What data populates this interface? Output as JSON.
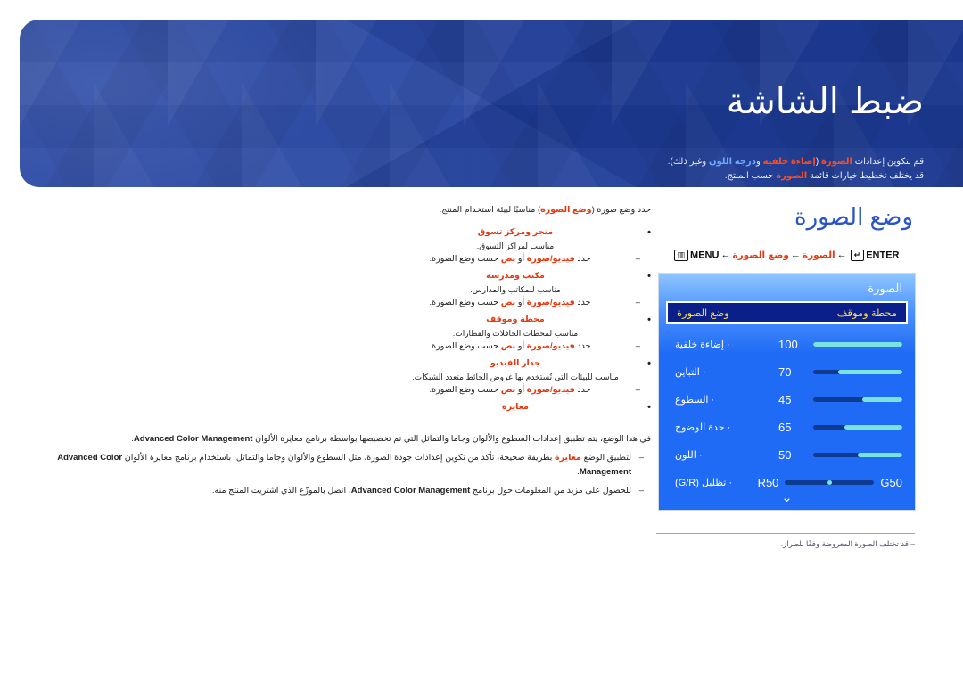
{
  "banner": {
    "title": "ضبط الشاشة",
    "sub_line1_pre": "قم بتكوين إعدادات ",
    "sub_line1_hl1": "الصورة",
    "sub_line1_mid": " (",
    "sub_line1_hl2": "إضاءة خلفية",
    "sub_line1_mid2": " و",
    "sub_line1_hl3": "درجة اللون",
    "sub_line1_end": " وغير ذلك).",
    "sub_line2_pre": "قد يختلف تخطيط خيارات قائمة ",
    "sub_line2_hl": "الصورة",
    "sub_line2_end": " حسب المنتج."
  },
  "section": {
    "title": "وضع الصورة",
    "menu_path": {
      "menu_label": "MENU",
      "menu_icon": "menu-grid-icon",
      "arrow": "←",
      "step1": "الصورة",
      "step2": "وضع الصورة",
      "enter_label": "ENTER",
      "enter_icon": "enter-key-icon"
    }
  },
  "osd": {
    "title": "الصورة",
    "highlight": {
      "label": "وضع الصورة",
      "value": "محطة وموقف"
    },
    "rows": [
      {
        "label": "· إضاءة خلفية",
        "value": "100",
        "fill_pct": 100
      },
      {
        "label": "· التباين",
        "value": "70",
        "fill_pct": 72
      },
      {
        "label": "· السطوع",
        "value": "45",
        "fill_pct": 45
      },
      {
        "label": "· حدة الوضوح",
        "value": "65",
        "fill_pct": 65
      },
      {
        "label": "· اللون",
        "value": "50",
        "fill_pct": 50
      }
    ],
    "rg_row": {
      "label": "· تظليل (G/R)",
      "left_value": "R50",
      "right_value": "G50"
    },
    "scroll_arrow": "chevron-down-icon",
    "note": "–  قد تختلف الصورة المعروضة وفقًا للطراز."
  },
  "content": {
    "lead_pre": "حدد وضع صورة (",
    "lead_hl": "وضع الصورة",
    "lead_post": ") مناسبًا لبيئة استخدام المنتج.",
    "items": [
      {
        "head": "متجر ومركز تسوق",
        "desc": "مناسب لمراكز التسوق.",
        "sub_pre": "حدد ",
        "sub_hl1": "فيديو/صورة",
        "sub_mid": " أو ",
        "sub_hl2": "نص",
        "sub_post": " حسب وضع الصورة."
      },
      {
        "head": "مكتب ومدرسة",
        "desc": "مناسب للمكاتب والمدارس.",
        "sub_pre": "حدد ",
        "sub_hl1": "فيديو/صورة",
        "sub_mid": " أو ",
        "sub_hl2": "نص",
        "sub_post": " حسب وضع الصورة."
      },
      {
        "head": "محطة وموقف",
        "desc": "مناسب لمحطات الحافلات والقطارات.",
        "sub_pre": "حدد ",
        "sub_hl1": "فيديو/صورة",
        "sub_mid": " أو ",
        "sub_hl2": "نص",
        "sub_post": " حسب وضع الصورة."
      },
      {
        "head": "جدار الفيديو",
        "desc": "مناسب للبيئات التي تُستخدم بها عروض الحائط متعدد الشبكات.",
        "sub_pre": "حدد ",
        "sub_hl1": "فيديو/صورة",
        "sub_mid": " أو ",
        "sub_hl2": "نص",
        "sub_post": " حسب وضع الصورة."
      }
    ],
    "calibration": {
      "head": "معايرة",
      "para1_pre": "في هذا الوضع، يتم تطبيق إعدادات السطوع والألوان وجاما والتماثل التي تم تخصيصها بواسطة برنامج معايرة الألوان ",
      "para1_bold": "Advanced Color Management",
      "para1_post": ".",
      "dash1_pre": "لتطبيق الوضع ",
      "dash1_hl": "معايرة",
      "dash1_mid": " بطريقة صحيحة، تأكد من تكوين إعدادات جودة الصورة، مثل السطوع والألوان وجاما والتماثل، باستخدام برنامج معايرة الألوان ",
      "dash1_bold": "Advanced Color Management",
      "dash1_post": ".",
      "dash2_pre": "للحصول على مزيد من المعلومات حول برنامج ",
      "dash2_bold": "Advanced Color Management",
      "dash2_post": "، اتصل بالموزّع الذي اشتريت المنتج منه."
    }
  },
  "colors": {
    "banner_blue": "#1f3fa0",
    "accent_red": "#e8380d",
    "section_blue": "#2a54c8",
    "osd_blue": "#1f6bf5",
    "osd_highlight_navy": "#0b1f8a",
    "osd_highlight_yellow": "#ffdf3d",
    "slider_fill": "#7ae3e0",
    "slider_track": "#0e3a8f"
  }
}
